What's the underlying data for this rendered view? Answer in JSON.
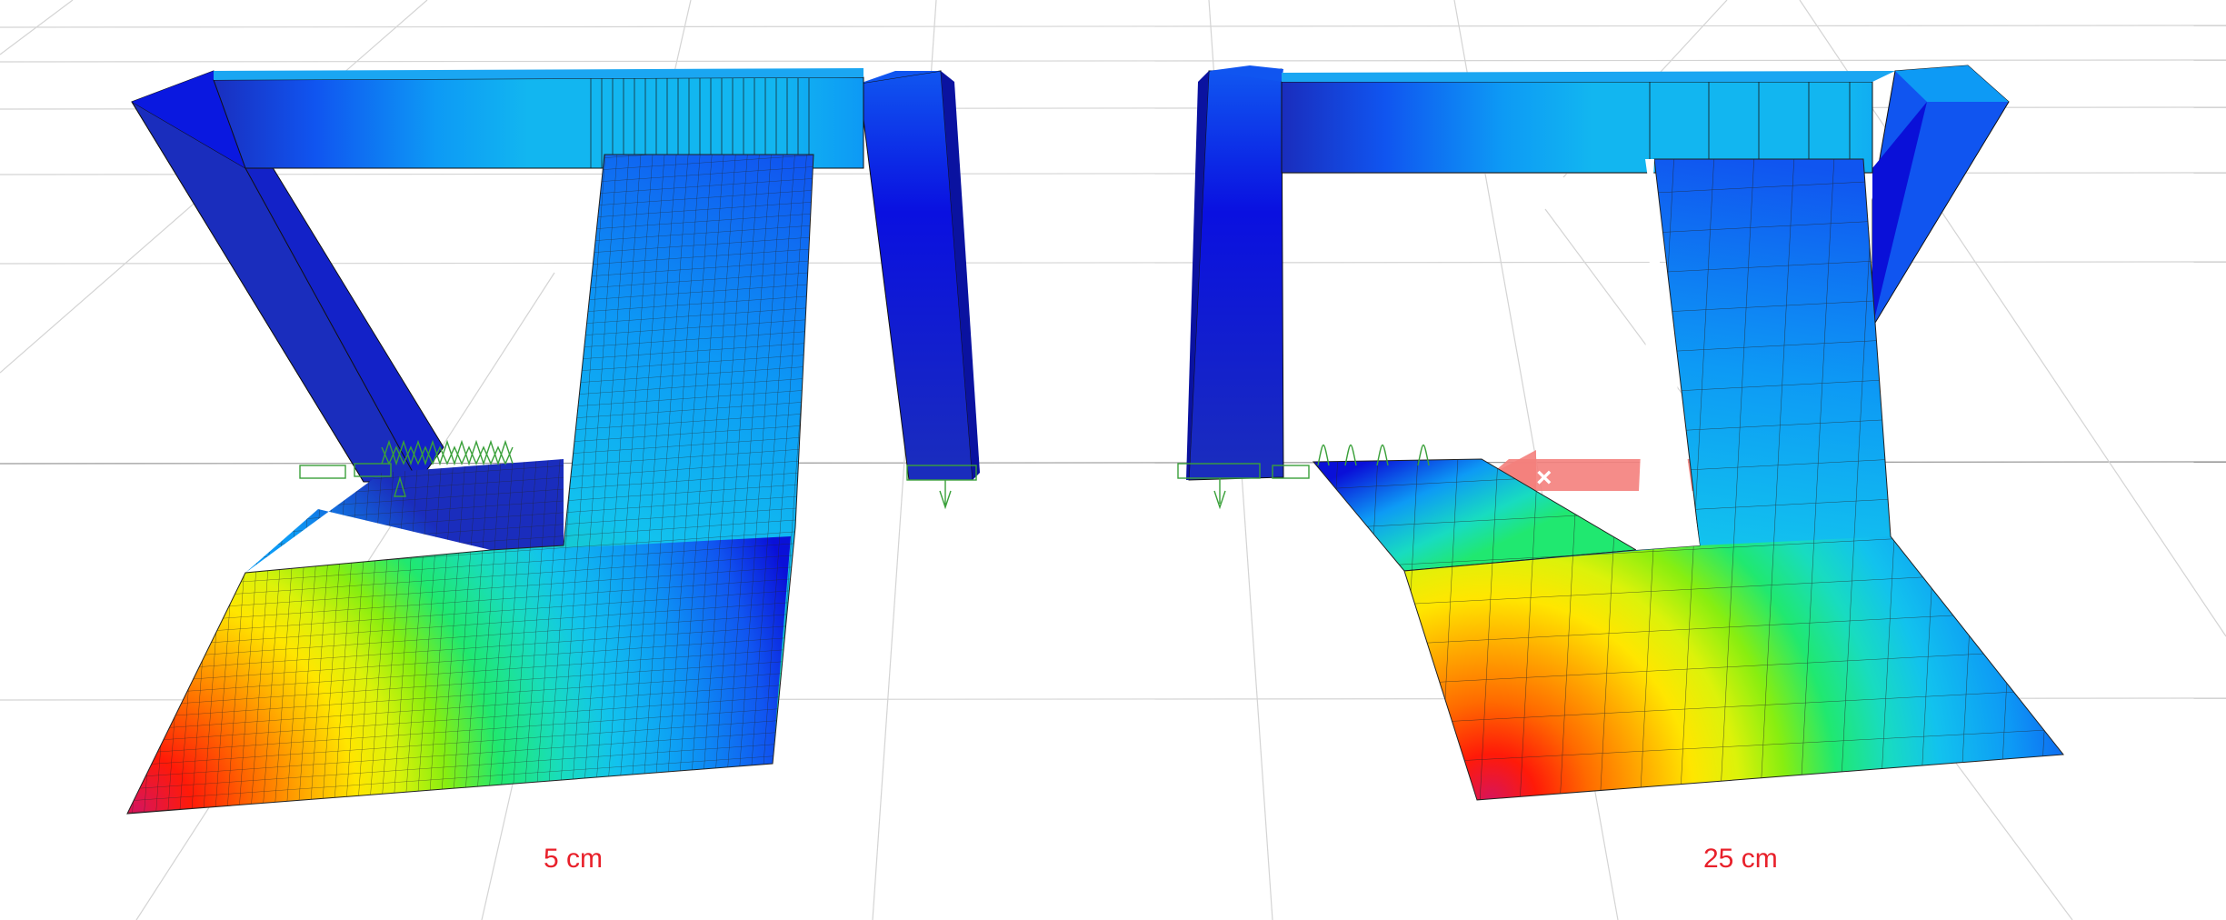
{
  "labels": {
    "left_mesh": "5 cm",
    "right_mesh": "25 cm"
  },
  "colors": {
    "label_red": "#e8202a",
    "grid_line": "#d4d4d4",
    "support_green": "#3aa03a",
    "axis_marker": "#f4807c",
    "frame_dark_blue": "#1a2dbd",
    "frame_light_blue": "#12b6f0",
    "mesh_line": "#222222"
  },
  "contour_palette": [
    "#0a10d8",
    "#1055f0",
    "#0d9af5",
    "#12c2ee",
    "#18dcc0",
    "#20e870",
    "#88ee10",
    "#dcf20a",
    "#ffe600",
    "#ffae00",
    "#ff6a00",
    "#ff1a08",
    "#d8145a"
  ],
  "icons": {
    "support": "spring-support-icon",
    "axis_marker": "x-axis-arrow-icon"
  }
}
